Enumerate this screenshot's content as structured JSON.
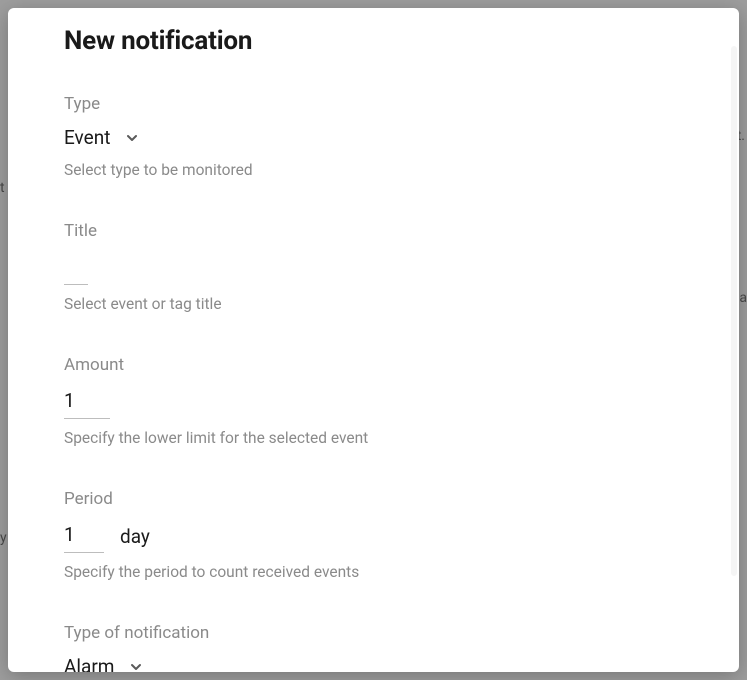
{
  "modal": {
    "title": "New notification"
  },
  "type": {
    "label": "Type",
    "value": "Event",
    "helper": "Select type to be monitored"
  },
  "title_field": {
    "label": "Title",
    "value": "",
    "helper": "Select event or tag title"
  },
  "amount": {
    "label": "Amount",
    "value": "1",
    "helper": "Specify the lower limit for the selected event"
  },
  "period": {
    "label": "Period",
    "value": "1",
    "unit": "day",
    "helper": "Specify the period to count received events"
  },
  "notif_type": {
    "label": "Type of notification",
    "value": "Alarm"
  }
}
